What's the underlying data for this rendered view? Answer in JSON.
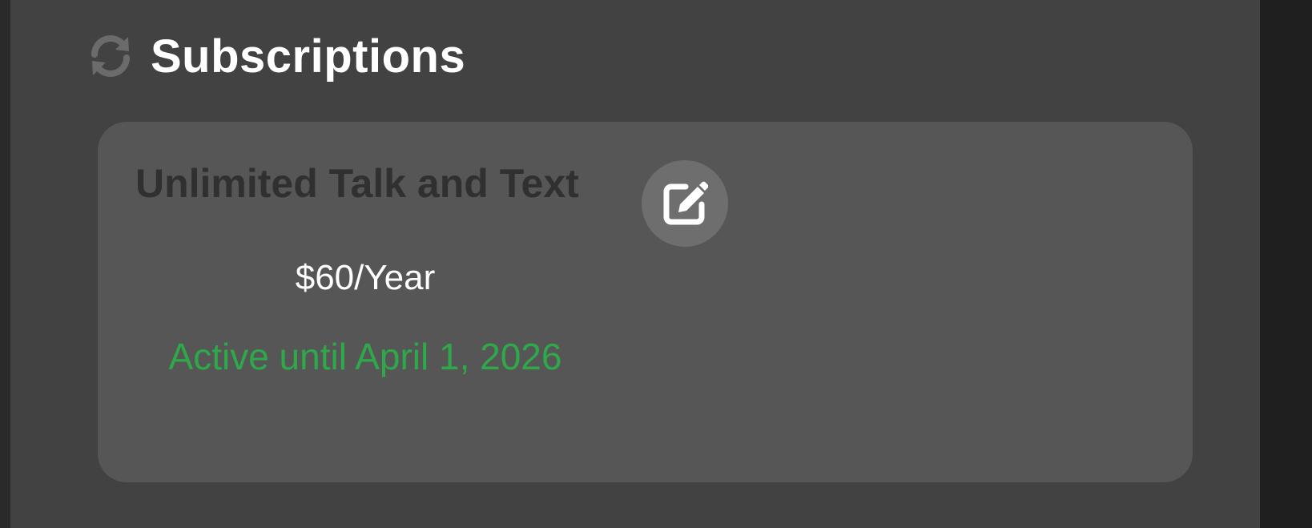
{
  "section": {
    "title": "Subscriptions",
    "icon": "sync-icon"
  },
  "subscription": {
    "name": "Unlimited Talk and Text",
    "price": "$60/Year",
    "status": "Active until April 1, 2026",
    "edit_icon": "edit-icon"
  },
  "colors": {
    "panel_background": "#424242",
    "card_background": "#565656",
    "status_active": "#2fa84a",
    "plan_name": "#303030",
    "icon_muted": "#6e6e6e"
  }
}
